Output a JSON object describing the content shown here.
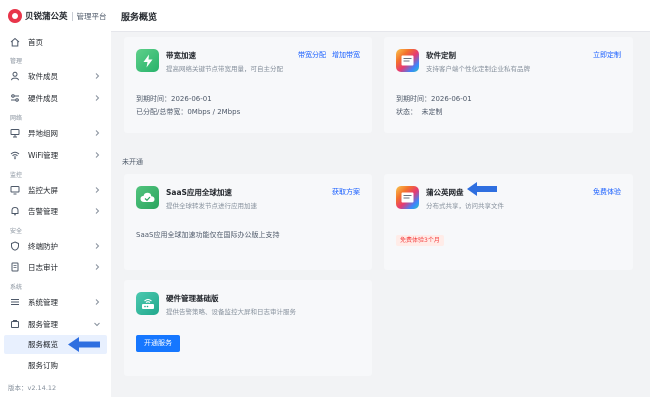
{
  "brand": {
    "name": "贝锐蒲公英",
    "subtitle": "管理平台"
  },
  "header": {
    "title": "服务概览"
  },
  "sidebar": {
    "home": "首页",
    "groups": [
      "管理",
      "网络",
      "监控",
      "安全",
      "系统"
    ],
    "items": [
      "软件成员",
      "硬件成员",
      "异地组网",
      "WiFi管理",
      "监控大屏",
      "告警管理",
      "终端防护",
      "日志审计",
      "系统管理",
      "服务管理"
    ],
    "subitems": [
      "服务概览",
      "服务订购"
    ],
    "version": "版本：v2.14.12"
  },
  "cards": {
    "bandwidth": {
      "title": "带宽加速",
      "desc": "提高网络关键节点带宽用量，可自主分配",
      "links": [
        "带宽分配",
        "增加带宽"
      ],
      "expiry": "到期时间：2026-06-01",
      "usage": "已分配/总带宽：0Mbps / 2Mbps"
    },
    "custom": {
      "title": "软件定制",
      "desc": "支持客户端个性化定制企业私有品牌",
      "link": "立即定制",
      "expiry": "到期时间：2026-06-01",
      "status": "状态：  未定制"
    },
    "not_enabled_label": "未开通",
    "saas": {
      "title": "SaaS应用全球加速",
      "desc": "提供全球转发节点进行应用加速",
      "link": "获取方案",
      "note": "SaaS应用全球加速功能仅在国际办公版上支持"
    },
    "disk": {
      "title": "蒲公英网盘",
      "desc": "分布式共享，访问共享文件",
      "link": "免费体验",
      "badge": "免费体验3个月"
    },
    "hardware": {
      "title": "硬件管理基础版",
      "desc": "提供告警策略、设备监控大屏和日志审计服务",
      "button": "开通服务"
    }
  },
  "colors": {
    "accent": "#165dff",
    "arrow": "#2f6fe0",
    "active_bg": "#e8f0fe"
  }
}
